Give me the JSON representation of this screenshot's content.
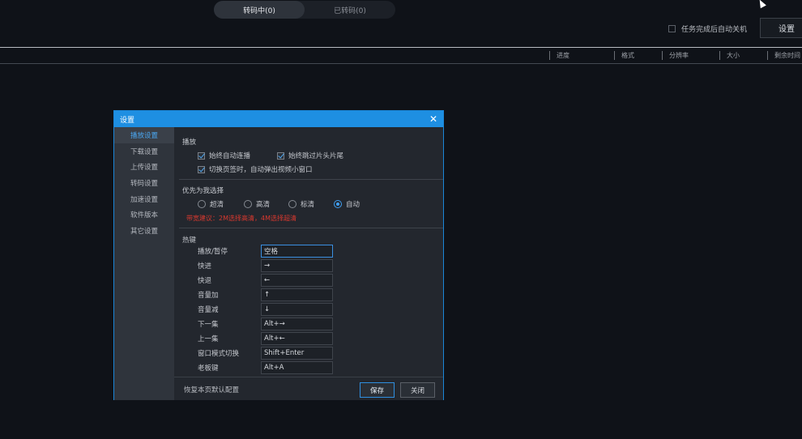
{
  "tabs": [
    {
      "label": "转码中(0)",
      "active": true
    },
    {
      "label": "已转码(0)",
      "active": false
    }
  ],
  "toolbar": {
    "auto_shutdown_label": "任务完成后自动关机",
    "settings_label": "设置"
  },
  "columns": [
    "进度",
    "格式",
    "分辨率",
    "大小",
    "剩余时间"
  ],
  "dialog": {
    "title": "设置",
    "sidebar": [
      {
        "label": "播放设置",
        "active": true
      },
      {
        "label": "下载设置",
        "active": false
      },
      {
        "label": "上传设置",
        "active": false
      },
      {
        "label": "转码设置",
        "active": false
      },
      {
        "label": "加速设置",
        "active": false
      },
      {
        "label": "软件版本",
        "active": false
      },
      {
        "label": "其它设置",
        "active": false
      }
    ],
    "play": {
      "section": "播放",
      "auto_continue": "始终自动连播",
      "skip_intro": "始终跳过片头片尾",
      "popup_small": "切换页签时，自动弹出视频小窗口"
    },
    "quality": {
      "section": "优先为我选择",
      "options": [
        "超清",
        "高清",
        "标清",
        "自动"
      ],
      "selected": "自动",
      "tip": "带宽建议：2M选择高清，4M选择超清"
    },
    "hotkeys": {
      "section": "热键",
      "rows": [
        {
          "label": "播放/暂停",
          "value": "空格"
        },
        {
          "label": "快进",
          "value": "→"
        },
        {
          "label": "快退",
          "value": "←"
        },
        {
          "label": "音量加",
          "value": "↑"
        },
        {
          "label": "音量减",
          "value": "↓"
        },
        {
          "label": "下一集",
          "value": "Alt+→"
        },
        {
          "label": "上一集",
          "value": "Alt+←"
        },
        {
          "label": "窗口模式切换",
          "value": "Shift+Enter"
        },
        {
          "label": "老板键",
          "value": "Alt+A"
        }
      ]
    },
    "footer": {
      "restore": "恢复本页默认配置",
      "save": "保存",
      "close": "关闭"
    },
    "colors": {
      "accent": "#1e8fe2",
      "warning": "#d8382e"
    }
  }
}
